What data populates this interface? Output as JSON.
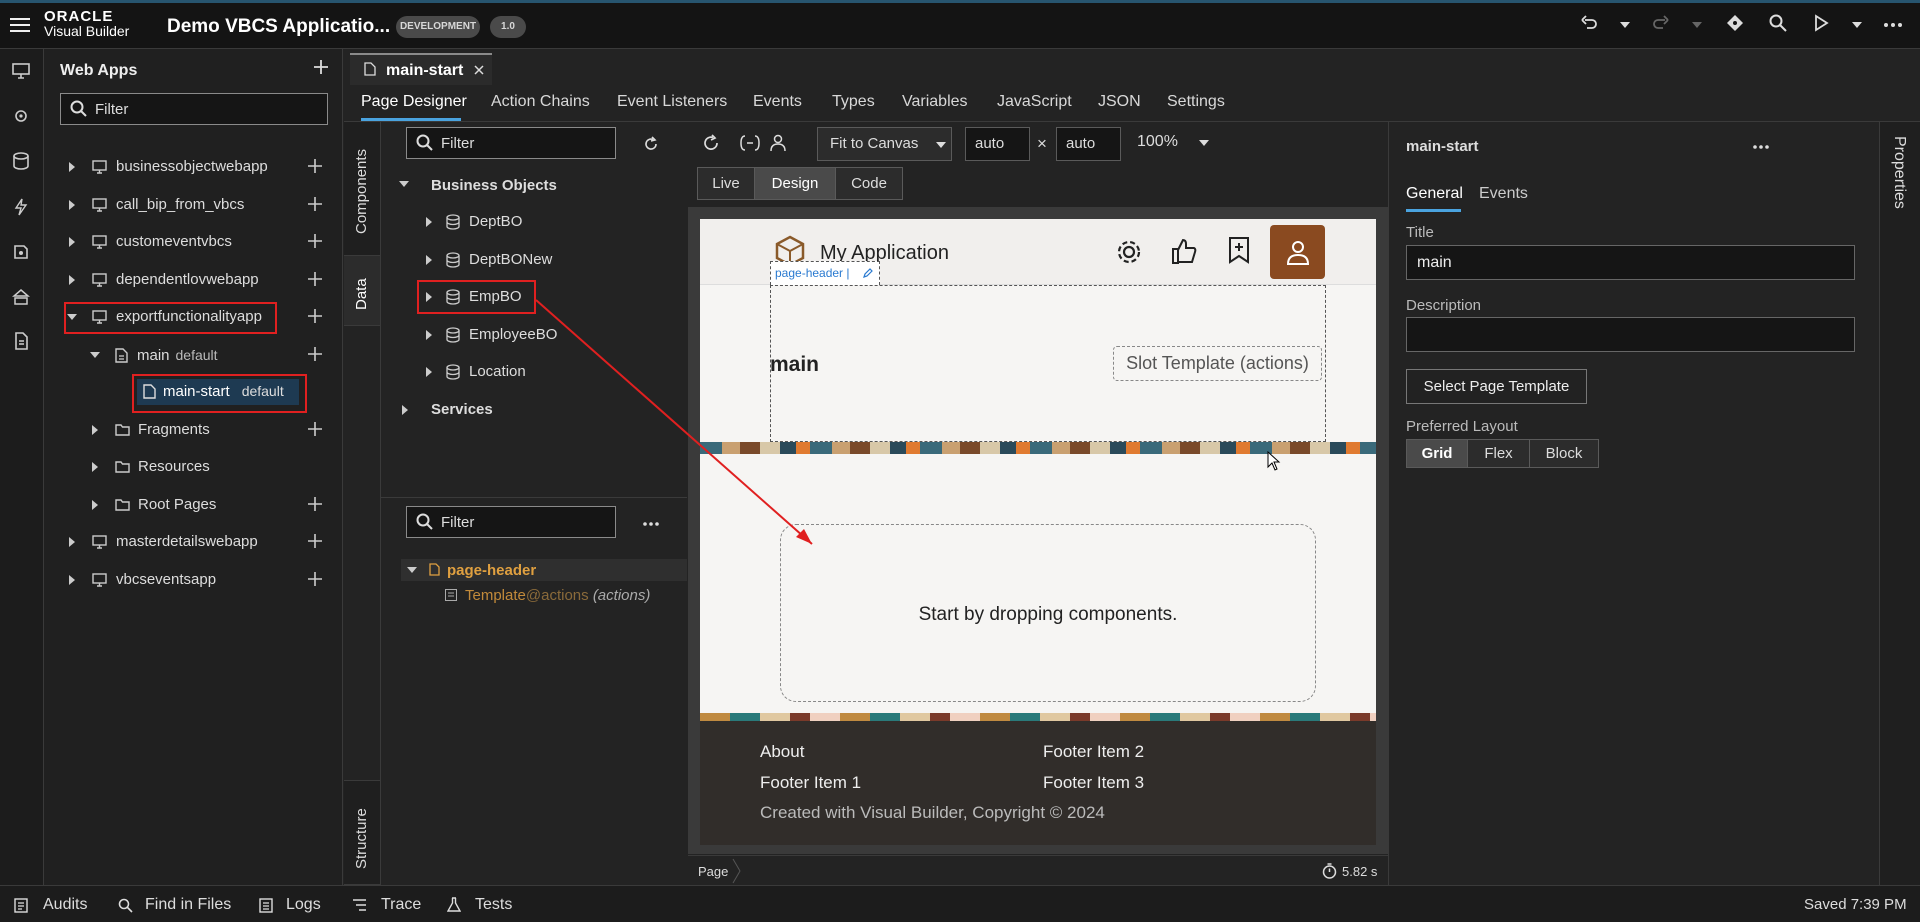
{
  "topbar": {
    "brand_line1": "ORACLE",
    "brand_line2": "Visual Builder",
    "app_title": "Demo VBCS Applicatio...",
    "env_badge": "DEVELOPMENT",
    "version_badge": "1.0"
  },
  "nav": {
    "title": "Web Apps",
    "filter_placeholder": "Filter",
    "items": [
      {
        "label": "businessobjectwebapp"
      },
      {
        "label": "call_bip_from_vbcs"
      },
      {
        "label": "customeventvbcs"
      },
      {
        "label": "dependentlovwebapp"
      },
      {
        "label": "exportfunctionalityapp"
      },
      {
        "label": "main",
        "tag": "default"
      },
      {
        "label": "main-start",
        "tag": "default"
      },
      {
        "label": "Fragments"
      },
      {
        "label": "Resources"
      },
      {
        "label": "Root Pages"
      },
      {
        "label": "masterdetailswebapp"
      },
      {
        "label": "vbcseventsapp"
      }
    ]
  },
  "editor": {
    "file_tab": "main-start",
    "tabs": [
      "Page Designer",
      "Action Chains",
      "Event Listeners",
      "Events",
      "Types",
      "Variables",
      "JavaScript",
      "JSON",
      "Settings"
    ],
    "side_tabs": {
      "components": "Components",
      "data": "Data",
      "structure": "Structure"
    }
  },
  "data_panel": {
    "filter_placeholder": "Filter",
    "business_objects": "Business Objects",
    "objects": [
      "DeptBO",
      "DeptBONew",
      "EmpBO",
      "EmployeeBO",
      "Location"
    ],
    "services": "Services"
  },
  "structure_panel": {
    "filter_placeholder": "Filter",
    "root": "page-header",
    "child_template": "Template",
    "child_slot": "@actions",
    "child_note": "(actions)"
  },
  "toolbar": {
    "fit": "Fit to Canvas",
    "width": "auto",
    "height": "auto",
    "times": "×",
    "zoom": "100%",
    "modes": [
      "Live",
      "Design",
      "Code"
    ]
  },
  "canvas": {
    "app_title": "My Application",
    "header_tag": "page-header",
    "page_title": "main",
    "slot_label": "Slot Template (actions)",
    "drop_text": "Start by dropping components.",
    "footer": {
      "col1": [
        "About",
        "Footer Item 1"
      ],
      "col2": [
        "Footer Item 2",
        "Footer Item 3"
      ],
      "copyright": "Created with Visual Builder, Copyright © 2024"
    },
    "breadcrumb": "Page",
    "timer": "5.82 s"
  },
  "properties": {
    "heading": "main-start",
    "tabs": [
      "General",
      "Events"
    ],
    "title_label": "Title",
    "title_value": "main",
    "description_label": "Description",
    "description_value": "",
    "select_template": "Select Page Template",
    "layout_label": "Preferred Layout",
    "layout_options": [
      "Grid",
      "Flex",
      "Block"
    ],
    "side_label": "Properties"
  },
  "statusbar": {
    "items": [
      "Audits",
      "Find in Files",
      "Logs",
      "Trace",
      "Tests"
    ],
    "saved": "Saved 7:39 PM"
  },
  "colors": {
    "accent": "#4aa3df",
    "annotation_red": "#e02020",
    "active_tab_bg": "#1e3a52"
  }
}
